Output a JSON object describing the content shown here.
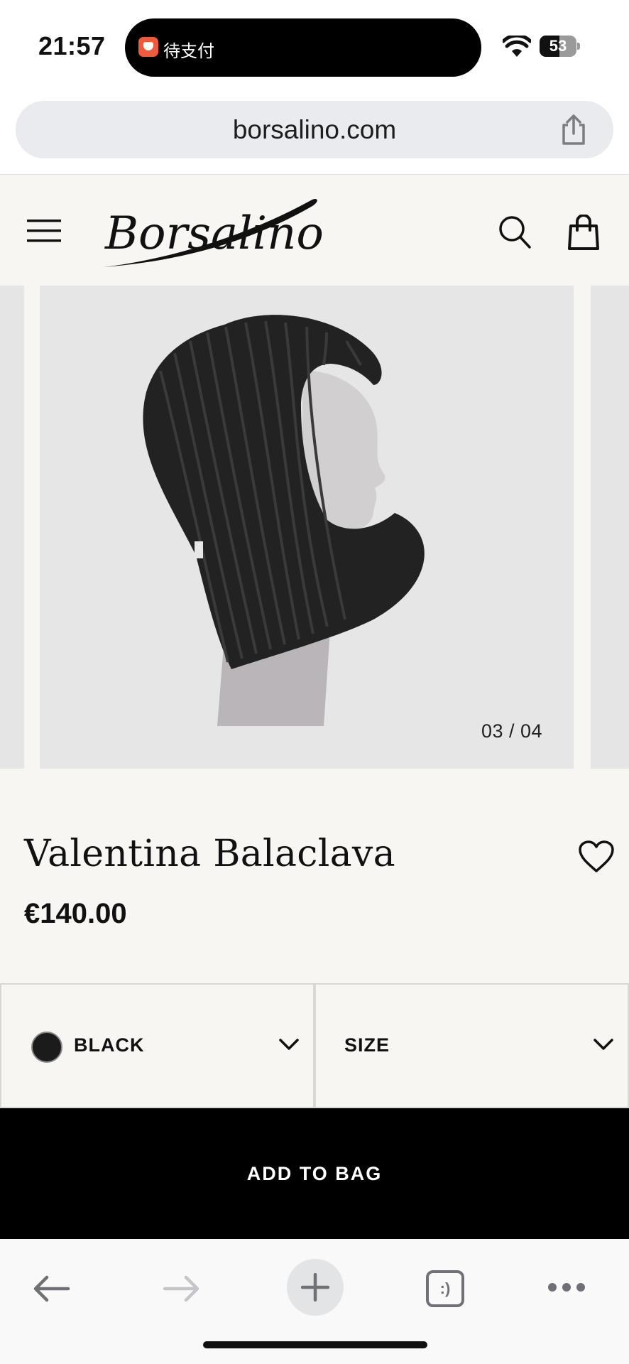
{
  "status_bar": {
    "time": "21:57",
    "island_text": "待支付",
    "battery_level": "53",
    "battery_fraction": 0.53,
    "wifi_icon": "wifi-icon"
  },
  "browser": {
    "url": "borsalino.com",
    "share_icon": "share-icon"
  },
  "header": {
    "menu_icon": "hamburger-menu-icon",
    "logo_text": "Borsalino",
    "search_icon": "search-icon",
    "bag_icon": "shopping-bag-icon"
  },
  "gallery": {
    "counter": "03 / 04",
    "image_description_icon": "product-photo"
  },
  "product": {
    "title": "Valentina Balaclava",
    "price": "€140.00",
    "wishlist_icon": "heart-icon"
  },
  "selectors": {
    "color_label": "BLACK",
    "color_hex": "#1b1b1b",
    "size_label": "SIZE",
    "chevron_icon": "chevron-down-icon"
  },
  "actions": {
    "add_to_bag_label": "ADD TO BAG"
  },
  "toolbar": {
    "back_icon": "back-arrow-icon",
    "forward_icon": "forward-arrow-icon",
    "new_tab_icon": "plus-icon",
    "tabs_label": ":)",
    "more_icon": "more-dots-icon"
  },
  "colors": {
    "page_background": "#f7f6f3",
    "image_background": "#e7e6e7",
    "button_background": "#000000",
    "address_bar": "#e9ebee"
  }
}
